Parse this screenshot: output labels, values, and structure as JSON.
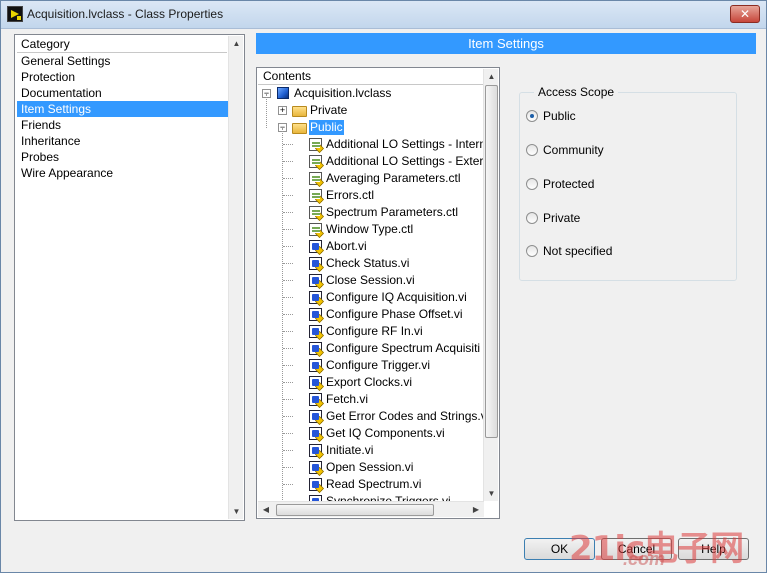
{
  "window": {
    "title": "Acquisition.lvclass - Class Properties",
    "close_glyph": "✕"
  },
  "category": {
    "header": "Category",
    "items": [
      "General Settings",
      "Protection",
      "Documentation",
      "Item Settings",
      "Friends",
      "Inheritance",
      "Probes",
      "Wire Appearance"
    ],
    "selected_index": 3
  },
  "item_settings": {
    "header": "Item Settings",
    "contents_header": "Contents",
    "root": "Acquisition.lvclass",
    "private_folder": "Private",
    "public_folder": "Public",
    "public_items": [
      {
        "label": "Additional LO Settings - Intern",
        "kind": "ctl"
      },
      {
        "label": "Additional LO Settings - Exter",
        "kind": "ctl"
      },
      {
        "label": "Averaging Parameters.ctl",
        "kind": "ctl"
      },
      {
        "label": "Errors.ctl",
        "kind": "ctl"
      },
      {
        "label": "Spectrum Parameters.ctl",
        "kind": "ctl"
      },
      {
        "label": "Window Type.ctl",
        "kind": "ctl"
      },
      {
        "label": "Abort.vi",
        "kind": "vi"
      },
      {
        "label": "Check Status.vi",
        "kind": "vi"
      },
      {
        "label": "Close Session.vi",
        "kind": "vi"
      },
      {
        "label": "Configure IQ Acquisition.vi",
        "kind": "vi"
      },
      {
        "label": "Configure Phase Offset.vi",
        "kind": "vi"
      },
      {
        "label": "Configure RF In.vi",
        "kind": "vi"
      },
      {
        "label": "Configure Spectrum Acquisiti",
        "kind": "vi"
      },
      {
        "label": "Configure Trigger.vi",
        "kind": "vi"
      },
      {
        "label": "Export Clocks.vi",
        "kind": "vi"
      },
      {
        "label": "Fetch.vi",
        "kind": "vi"
      },
      {
        "label": "Get Error Codes and Strings.vi",
        "kind": "vi"
      },
      {
        "label": "Get IQ Components.vi",
        "kind": "vi"
      },
      {
        "label": "Initiate.vi",
        "kind": "vi"
      },
      {
        "label": "Open Session.vi",
        "kind": "vi"
      },
      {
        "label": "Read Spectrum.vi",
        "kind": "vi"
      },
      {
        "label": "Synchronize Triggers.vi",
        "kind": "vi"
      }
    ]
  },
  "access_scope": {
    "legend": "Access Scope",
    "options": [
      "Public",
      "Community",
      "Protected",
      "Private",
      "Not specified"
    ],
    "selected_index": 0
  },
  "buttons": {
    "ok": "OK",
    "cancel": "Cancel",
    "help": "Help"
  },
  "watermark": {
    "brand": "21ic电子网",
    "url": ".com"
  }
}
